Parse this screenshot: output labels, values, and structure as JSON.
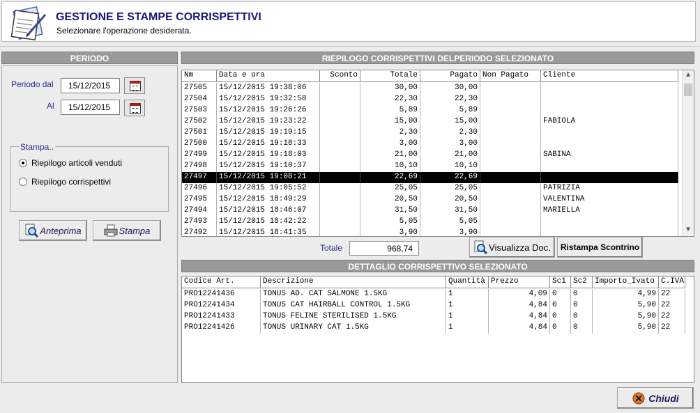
{
  "header": {
    "title": "GESTIONE E STAMPE CORRISPETTIVI",
    "subtitle": "Selezionare l'operazione desiderata."
  },
  "periodo": {
    "title": "PERIODO",
    "dal_label": "Periodo dal",
    "dal_value": "15/12/2015",
    "al_label": "Al",
    "al_value": "15/12/2015"
  },
  "stampa": {
    "legend": "Stampa..",
    "options": [
      {
        "label": "Riepilogo articoli venduti",
        "checked": true
      },
      {
        "label": "Riepilogo corrispettivi",
        "checked": false
      }
    ]
  },
  "buttons": {
    "anteprima": "Anteprima",
    "stampa": "Stampa",
    "visualizza": "Visualizza Doc.",
    "ristampa": "Ristampa Scontrino",
    "chiudi": "Chiudi"
  },
  "riepilogo": {
    "title": "RIEPILOGO CORRISPETTIVI DELPERIODO SELEZIONATO",
    "columns": [
      "Nm",
      "Data e ora",
      "Sconto",
      "Totale",
      "Pagato",
      "Non Pagato",
      "Cliente"
    ],
    "rows": [
      {
        "nm": "27505",
        "data": "15/12/2015 19:38:06",
        "sconto": "",
        "totale": "30,00",
        "pagato": "30,00",
        "non_pagato": "",
        "cliente": ""
      },
      {
        "nm": "27504",
        "data": "15/12/2015 19:32:58",
        "sconto": "",
        "totale": "22,30",
        "pagato": "22,30",
        "non_pagato": "",
        "cliente": ""
      },
      {
        "nm": "27503",
        "data": "15/12/2015 19:26:26",
        "sconto": "",
        "totale": "5,89",
        "pagato": "5,89",
        "non_pagato": "",
        "cliente": ""
      },
      {
        "nm": "27502",
        "data": "15/12/2015 19:23:22",
        "sconto": "",
        "totale": "15,00",
        "pagato": "15,00",
        "non_pagato": "",
        "cliente": "FABIOLA"
      },
      {
        "nm": "27501",
        "data": "15/12/2015 19:19:15",
        "sconto": "",
        "totale": "2,30",
        "pagato": "2,30",
        "non_pagato": "",
        "cliente": ""
      },
      {
        "nm": "27500",
        "data": "15/12/2015 19:18:33",
        "sconto": "",
        "totale": "3,00",
        "pagato": "3,00",
        "non_pagato": "",
        "cliente": ""
      },
      {
        "nm": "27499",
        "data": "15/12/2015 19:18:03",
        "sconto": "",
        "totale": "21,00",
        "pagato": "21,00",
        "non_pagato": "",
        "cliente": "SABINA"
      },
      {
        "nm": "27498",
        "data": "15/12/2015 19:10:37",
        "sconto": "",
        "totale": "10,10",
        "pagato": "10,10",
        "non_pagato": "",
        "cliente": ""
      },
      {
        "nm": "27497",
        "data": "15/12/2015 19:08:21",
        "sconto": "",
        "totale": "22,69",
        "pagato": "22,69",
        "non_pagato": "",
        "cliente": "",
        "selected": true
      },
      {
        "nm": "27496",
        "data": "15/12/2015 19:05:52",
        "sconto": "",
        "totale": "25,05",
        "pagato": "25,05",
        "non_pagato": "",
        "cliente": "PATRIZIA"
      },
      {
        "nm": "27495",
        "data": "15/12/2015 18:49:29",
        "sconto": "",
        "totale": "20,50",
        "pagato": "20,50",
        "non_pagato": "",
        "cliente": "VALENTINA"
      },
      {
        "nm": "27494",
        "data": "15/12/2015 18:46:07",
        "sconto": "",
        "totale": "31,50",
        "pagato": "31,50",
        "non_pagato": "",
        "cliente": "MARIELLA"
      },
      {
        "nm": "27493",
        "data": "15/12/2015 18:42:22",
        "sconto": "",
        "totale": "5,05",
        "pagato": "5,05",
        "non_pagato": "",
        "cliente": ""
      },
      {
        "nm": "27492",
        "data": "15/12/2015 18:41:35",
        "sconto": "",
        "totale": "3,90",
        "pagato": "3,90",
        "non_pagato": "",
        "cliente": ""
      }
    ],
    "totale_label": "Totale",
    "totale_value": "968,74"
  },
  "dettaglio": {
    "title": "DETTAGLIO CORRISPETTIVO SELEZIONATO",
    "columns": [
      "Codice Art.",
      "Descrizione",
      "Quantità",
      "Prezzo",
      "Sc1",
      "Sc2",
      "Importo_Ivato",
      "C.IVA"
    ],
    "rows": [
      {
        "codice": "PRO12241436",
        "descrizione": "TONUS AD. CAT SALMONE 1.5KG",
        "quantita": "1",
        "prezzo": "4,09",
        "sc1": "0",
        "sc2": "0",
        "importo": "4,99",
        "iva": "22"
      },
      {
        "codice": "PRO12241434",
        "descrizione": "TONUS CAT HAIRBALL CONTROL 1.5KG",
        "quantita": "1",
        "prezzo": "4,84",
        "sc1": "0",
        "sc2": "0",
        "importo": "5,90",
        "iva": "22"
      },
      {
        "codice": "PRO12241433",
        "descrizione": "TONUS FELINE STERILISED 1.5KG",
        "quantita": "1",
        "prezzo": "4,84",
        "sc1": "0",
        "sc2": "0",
        "importo": "5,90",
        "iva": "22"
      },
      {
        "codice": "PRO12241426",
        "descrizione": "TONUS URINARY CAT 1.5KG",
        "quantita": "1",
        "prezzo": "4,84",
        "sc1": "0",
        "sc2": "0",
        "importo": "5,90",
        "iva": "22"
      }
    ]
  }
}
